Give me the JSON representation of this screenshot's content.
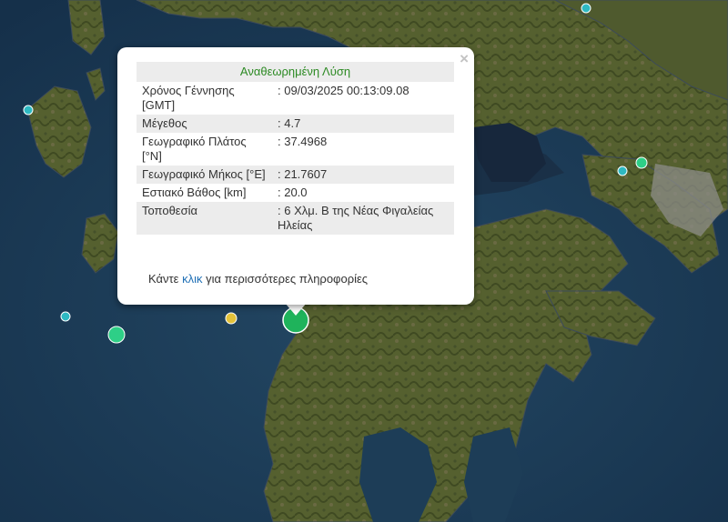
{
  "map": {
    "colors": {
      "sea": "#1d3d57",
      "land": "#4e5a2c",
      "city": "#8c8c88",
      "lake": "#17273c"
    },
    "markers": [
      {
        "color": "#2eb9c2",
        "shape": "circle"
      },
      {
        "color": "#2eb9c2",
        "shape": "circle"
      },
      {
        "color": "#2eb9c2",
        "shape": "circle"
      },
      {
        "color": "#2eb9c2",
        "shape": "circle"
      },
      {
        "color": "#2ecf87",
        "shape": "circle"
      },
      {
        "color": "#2ecf87",
        "shape": "circle"
      },
      {
        "color": "#e3c23a",
        "shape": "circle"
      },
      {
        "color": "#1fb35b",
        "shape": "circle"
      }
    ]
  },
  "popup": {
    "title": "Αναθεωρημένη Λύση",
    "close_icon": "×",
    "rows": [
      {
        "key": "Χρόνος Γέννησης [GMT]",
        "value": ": 09/03/2025 00:13:09.08"
      },
      {
        "key": "Μέγεθος",
        "value": ": 4.7"
      },
      {
        "key": "Γεωγραφικό Πλάτος [°N]",
        "value": ": 37.4968"
      },
      {
        "key": "Γεωγραφικό Μήκος [°E]",
        "value": ": 21.7607"
      },
      {
        "key": "Εστιακό Βάθος [km]",
        "value": ": 20.0"
      },
      {
        "key": "Τοποθεσία",
        "value": ": 6 Χλμ. Β της Νέας Φιγαλείας Ηλείας"
      }
    ],
    "more_prefix": "Κάντε ",
    "more_link": "κλικ",
    "more_suffix": " για περισσότερες πληροφορίες"
  }
}
